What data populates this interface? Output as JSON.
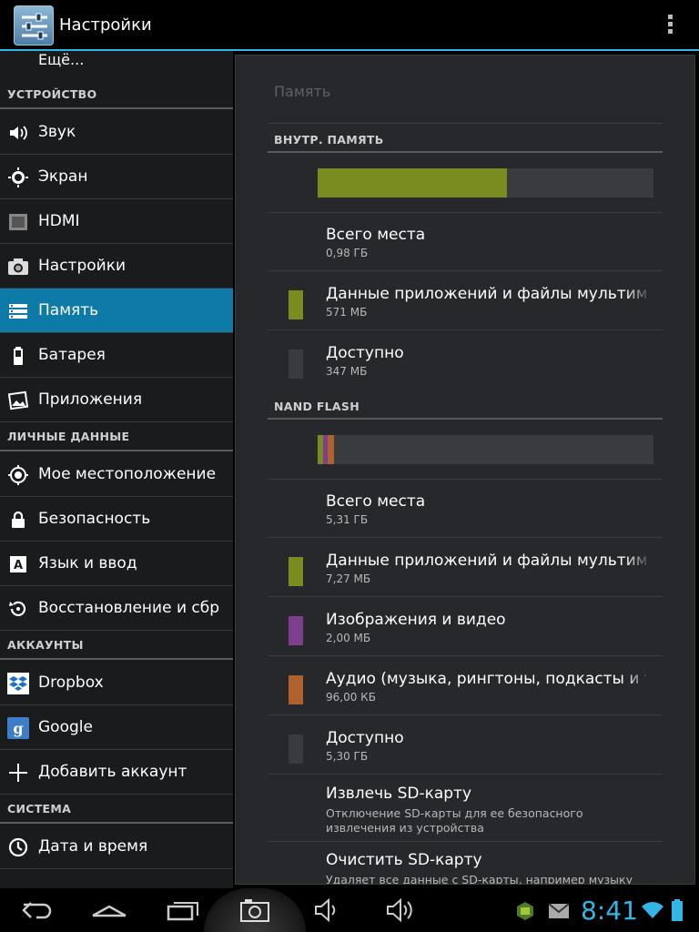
{
  "app": {
    "title": "Настройки"
  },
  "left": {
    "more_label": "Ещё...",
    "sections": {
      "device": "УСТРОЙСТВО",
      "personal": "ЛИЧНЫЕ ДАННЫЕ",
      "accounts": "АККАУНТЫ",
      "system": "СИСТЕМА"
    },
    "items": {
      "sound": "Звук",
      "display": "Экран",
      "hdmi": "HDMI",
      "camera": "Настройки",
      "storage": "Память",
      "battery": "Батарея",
      "apps": "Приложения",
      "location": "Мое местоположение",
      "security": "Безопасность",
      "language": "Язык и ввод",
      "backup": "Восстановление и сброс",
      "dropbox": "Dropbox",
      "google": "Google",
      "add_account": "Добавить аккаунт",
      "datetime": "Дата и время"
    },
    "active_item": "storage"
  },
  "storage": {
    "title": "Память",
    "internal": {
      "header": "ВНУТР. ПАМЯТЬ",
      "usage_fraction": {
        "apps": 0.565
      },
      "total_label": "Всего места",
      "total_value": "0,98 ГБ",
      "apps_label": "Данные приложений и файлы мультимедиа",
      "apps_value": "571 МБ",
      "free_label": "Доступно",
      "free_value": "347 МБ"
    },
    "nand": {
      "header": "NAND FLASH",
      "usage_fraction": {
        "apps": 0.016,
        "images": 0.013,
        "audio": 0.019
      },
      "total_label": "Всего места",
      "total_value": "5,31 ГБ",
      "apps_label": "Данные приложений и файлы мультимедиа",
      "apps_value": "7,27 МБ",
      "images_label": "Изображения и видео",
      "images_value": "2,00 МБ",
      "audio_label": "Аудио (музыка, рингтоны, подкасты и т. п.)",
      "audio_value": "96,00 КБ",
      "free_label": "Доступно",
      "free_value": "5,30 ГБ"
    },
    "eject": {
      "label": "Извлечь SD-карту",
      "desc": "Отключение SD-карты для ее безопасного извлечения из устройства"
    },
    "erase": {
      "label": "Очистить SD-карту",
      "desc": "Удаляет все данные с SD-карты, например музыку и фотографии"
    }
  },
  "colors": {
    "accent": "#33b5e5",
    "active_row": "#0e7aa8",
    "apps": "#7a8c20",
    "images": "#7f3f8f",
    "audio": "#b0612e",
    "free": "#3a3b3e"
  },
  "statusbar": {
    "time": "8:41"
  }
}
